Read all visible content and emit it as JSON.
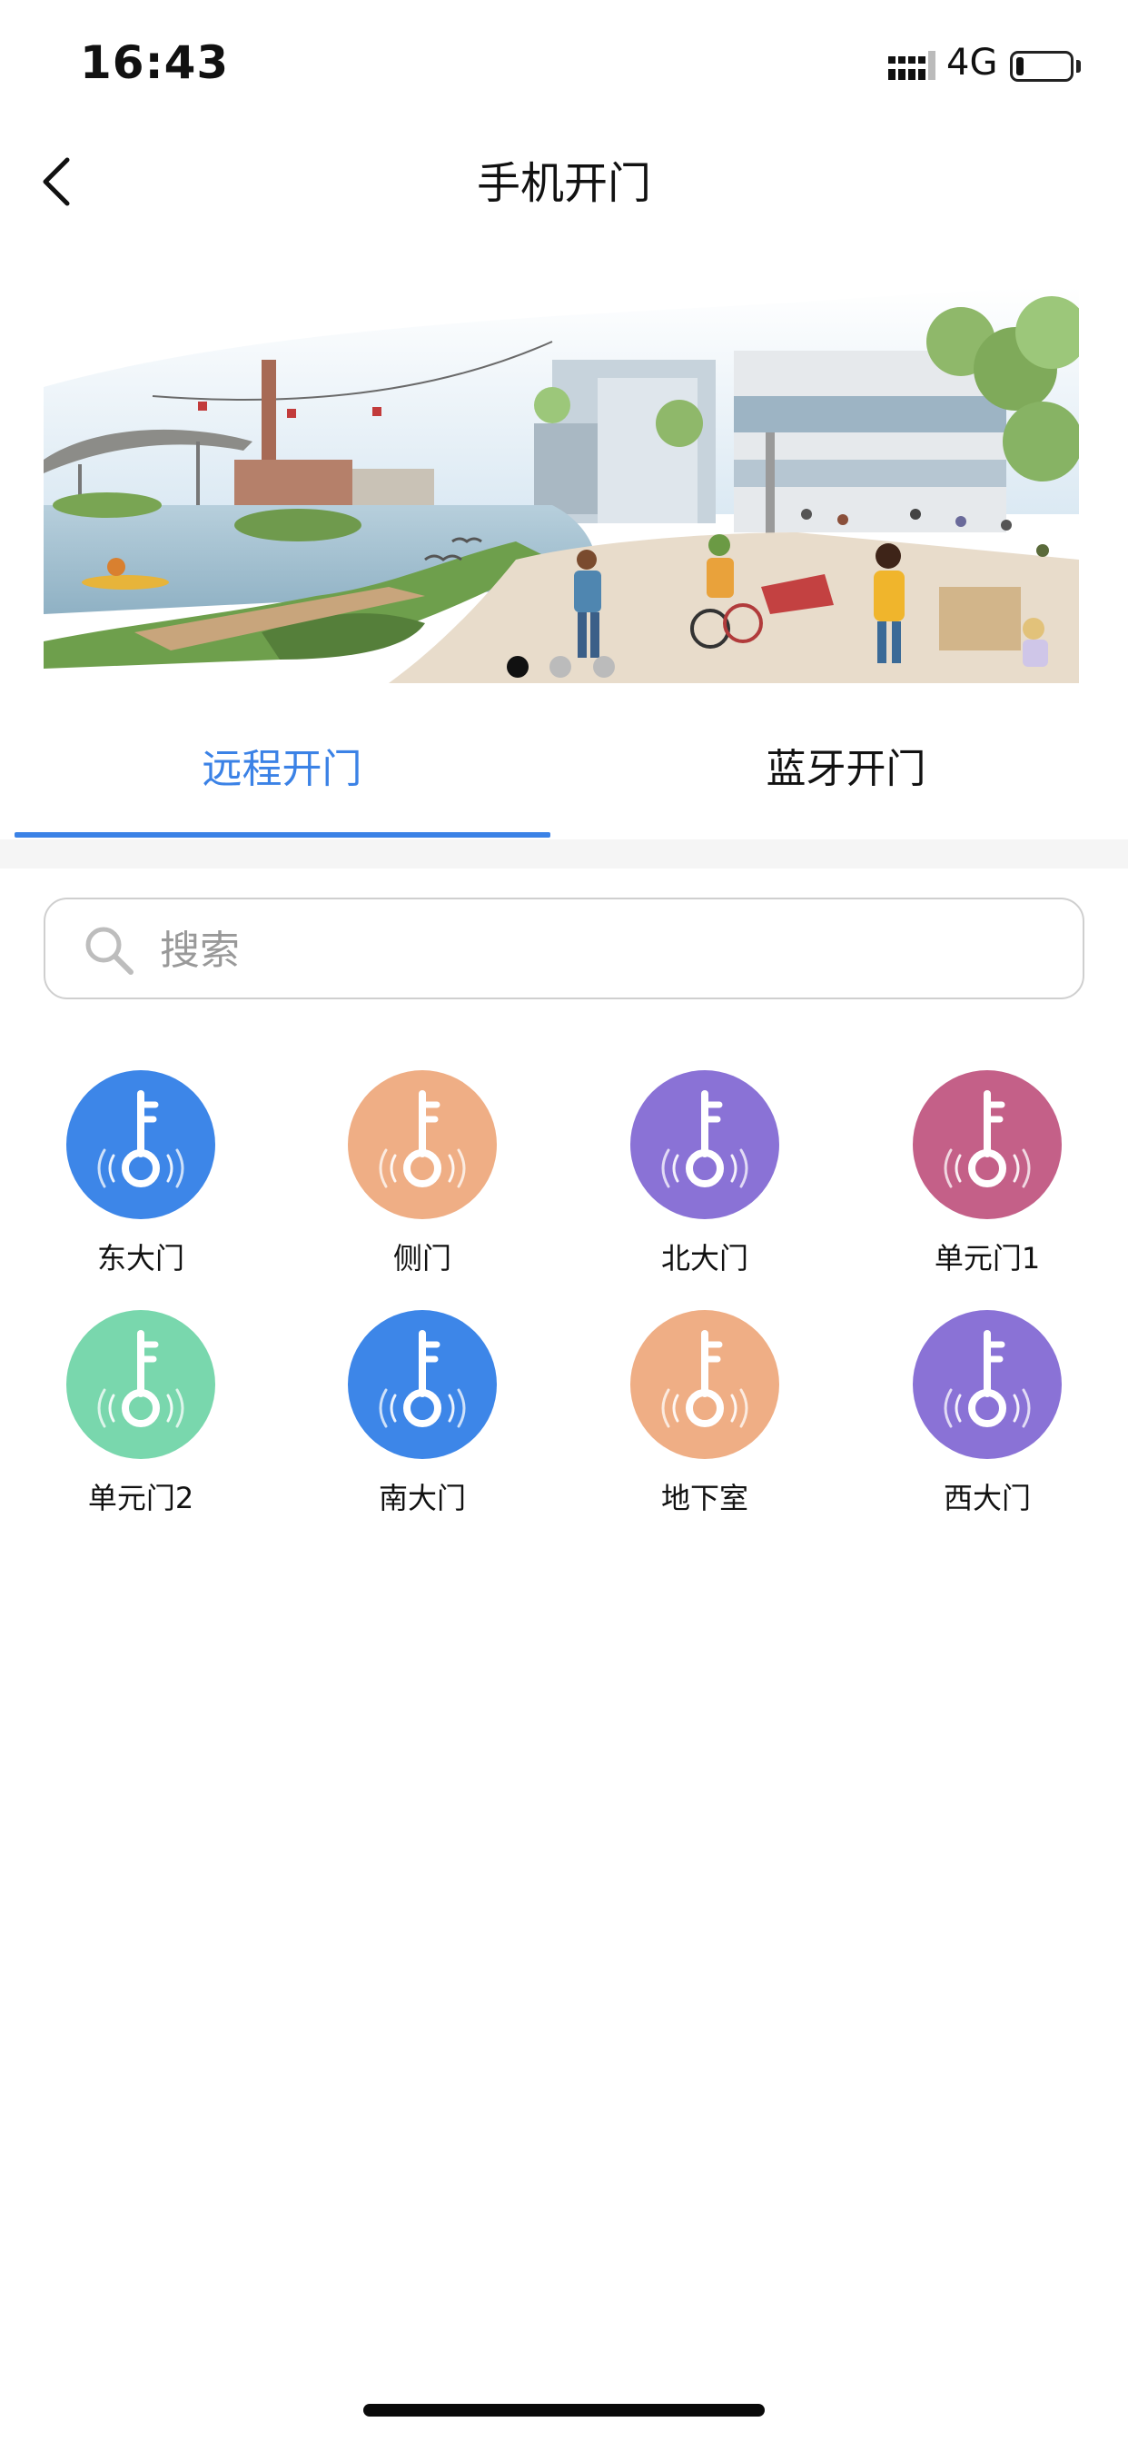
{
  "status_bar": {
    "time": "16:43",
    "network": "4G",
    "battery_level": 0.15
  },
  "header": {
    "title": "手机开门",
    "back_icon": "chevron-left-icon"
  },
  "banner": {
    "image": "city-waterfront-illustration",
    "pages": 3,
    "active_page": 1
  },
  "tabs": [
    {
      "label": "远程开门",
      "active": true
    },
    {
      "label": "蓝牙开门",
      "active": false
    }
  ],
  "search": {
    "placeholder": "搜索",
    "value": "",
    "icon": "search-icon"
  },
  "doors": [
    {
      "label": "东大门",
      "color": "#3d86e8",
      "icon": "key-icon"
    },
    {
      "label": "侧门",
      "color": "#efae85",
      "icon": "key-icon"
    },
    {
      "label": "北大门",
      "color": "#8a72d6",
      "icon": "key-icon"
    },
    {
      "label": "单元门1",
      "color": "#c46088",
      "icon": "key-icon"
    },
    {
      "label": "单元门2",
      "color": "#79d7ad",
      "icon": "key-icon"
    },
    {
      "label": "南大门",
      "color": "#3d86e8",
      "icon": "key-icon"
    },
    {
      "label": "地下室",
      "color": "#efae85",
      "icon": "key-icon"
    },
    {
      "label": "西大门",
      "color": "#8a72d6",
      "icon": "key-icon"
    }
  ],
  "colors": {
    "accent": "#3b82e6"
  }
}
